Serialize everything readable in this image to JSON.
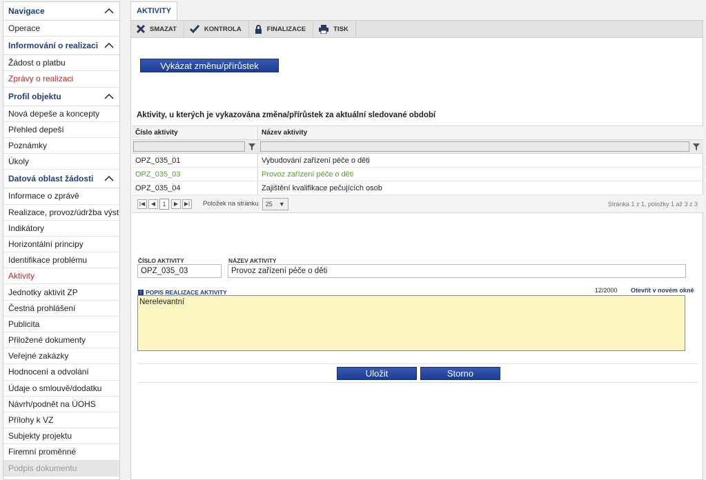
{
  "sidebar": {
    "sections": [
      {
        "title": "Navigace",
        "items": [
          {
            "label": "Operace",
            "state": "normal"
          }
        ]
      },
      {
        "title": "Informování o realizaci",
        "items": [
          {
            "label": "Žádost o platbu",
            "state": "normal"
          },
          {
            "label": "Zprávy o realizaci",
            "state": "red"
          }
        ]
      },
      {
        "title": "Profil objektu",
        "items": [
          {
            "label": "Nová depeše a koncepty",
            "state": "normal"
          },
          {
            "label": "Přehled depeší",
            "state": "normal"
          },
          {
            "label": "Poznámky",
            "state": "normal"
          },
          {
            "label": "Úkoly",
            "state": "normal"
          }
        ]
      },
      {
        "title": "Datová oblast žádosti",
        "items": [
          {
            "label": "Informace o zprávě",
            "state": "normal"
          },
          {
            "label": "Realizace, provoz/údržba výstupu",
            "state": "normal"
          },
          {
            "label": "Indikátory",
            "state": "normal"
          },
          {
            "label": "Horizontální principy",
            "state": "normal"
          },
          {
            "label": "Identifikace problému",
            "state": "normal"
          },
          {
            "label": "Aktivity",
            "state": "red"
          },
          {
            "label": "Jednotky aktivit ZP",
            "state": "normal"
          },
          {
            "label": "Čestná prohlášení",
            "state": "normal"
          },
          {
            "label": "Publicita",
            "state": "normal"
          },
          {
            "label": "Přiložené dokumenty",
            "state": "normal"
          },
          {
            "label": "Veřejné zakázky",
            "state": "normal"
          },
          {
            "label": "Hodnocení a odvolání",
            "state": "normal"
          },
          {
            "label": "Údaje o smlouvě/dodatku",
            "state": "normal"
          },
          {
            "label": "Návrh/podnět na ÚOHS",
            "state": "normal"
          },
          {
            "label": "Přílohy k VZ",
            "state": "normal"
          },
          {
            "label": "Subjekty projektu",
            "state": "normal"
          },
          {
            "label": "Firemní proměnné",
            "state": "normal"
          },
          {
            "label": "Podpis dokumentu",
            "state": "disabled"
          }
        ]
      }
    ]
  },
  "tab": {
    "label": "AKTIVITY"
  },
  "toolbar": {
    "delete": "SMAZAT",
    "check": "KONTROLA",
    "finalize": "FINALIZACE",
    "print": "TISK"
  },
  "report_button": "Vykázat změnu/přírůstek",
  "grid": {
    "title": "Aktivity, u kterých je vykazována změna/přírůstek za aktuální sledované období",
    "col_number": "Číslo aktivity",
    "col_name": "Název aktivity",
    "rows": [
      {
        "number": "OPZ_035_01",
        "name": "Vybudování zařízení péče o děti"
      },
      {
        "number": "OPZ_035_03",
        "name": "Provoz zařízení péče o děti"
      },
      {
        "number": "OPZ_035_04",
        "name": "Zajištění kvalifikace pečujících osob"
      }
    ],
    "selected_index": 1,
    "pager": {
      "current_page": "1",
      "per_page_label": "Položek na stránku",
      "per_page": "25",
      "info": "Stránka 1 z 1, položky 1 až 3 z 3"
    }
  },
  "detail": {
    "number_label": "ČÍSLO AKTIVITY",
    "number_value": "OPZ_035_03",
    "name_label": "NÁZEV AKTIVITY",
    "name_value": "Provoz zařízení péče o děti",
    "desc_label": "POPIS REALIZACE AKTIVITY",
    "desc_counter": "12/2000",
    "desc_open": "Otevřít v novém okně",
    "desc_value": "Nerelevantní"
  },
  "actions": {
    "save": "Uložit",
    "cancel": "Storno"
  },
  "colors": {
    "nav_blue": "#1f3f7f",
    "red": "#c0261f",
    "selected_green": "#55a02d",
    "textarea_yellow": "#fcf7c2"
  }
}
